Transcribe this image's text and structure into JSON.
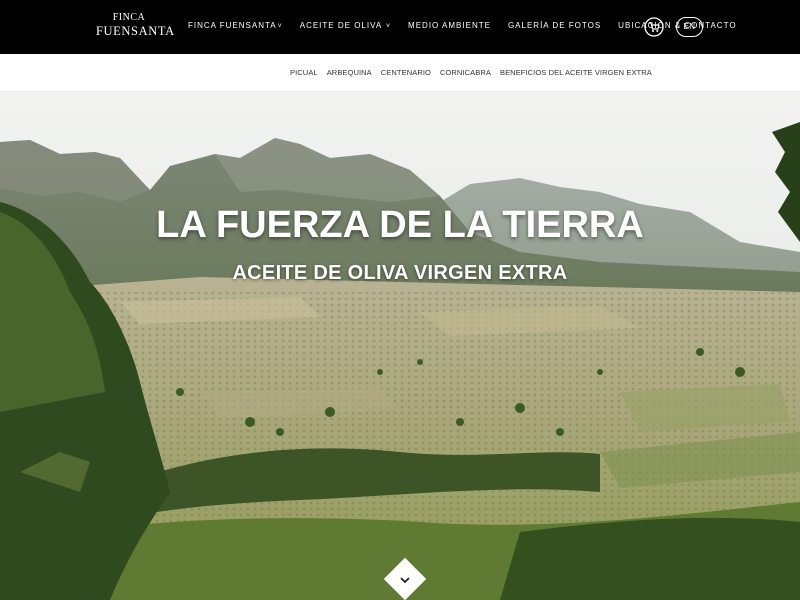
{
  "logo": {
    "line1": "FINCA",
    "line2": "FUENSANTA"
  },
  "nav": {
    "items": [
      {
        "label": "Finca Fuensanta",
        "caret": "˅"
      },
      {
        "label": "Aceite de oliva",
        "caret": "˅"
      },
      {
        "label": "Medio ambiente"
      },
      {
        "label": "Galería de fotos"
      },
      {
        "label": "Ubicación & contacto"
      }
    ],
    "cart_icon": "shopping-cart-icon",
    "language": "EN"
  },
  "subnav": {
    "items": [
      "Picual",
      "Arbequina",
      "Centenario",
      "Cornicabra",
      "Beneficios del aceite virgen extra"
    ]
  },
  "hero": {
    "title": "LA FUERZA DE LA TIERRA",
    "subtitle": "ACEITE DE OLIVA VIRGEN EXTRA",
    "scroll_icon": "chevron-down-icon"
  },
  "colors": {
    "topbar": "#000000",
    "sky": "#e9ebe9",
    "mountains": "#8a9486",
    "fields": "#b9b48c",
    "trees": "#3f5a2a"
  }
}
